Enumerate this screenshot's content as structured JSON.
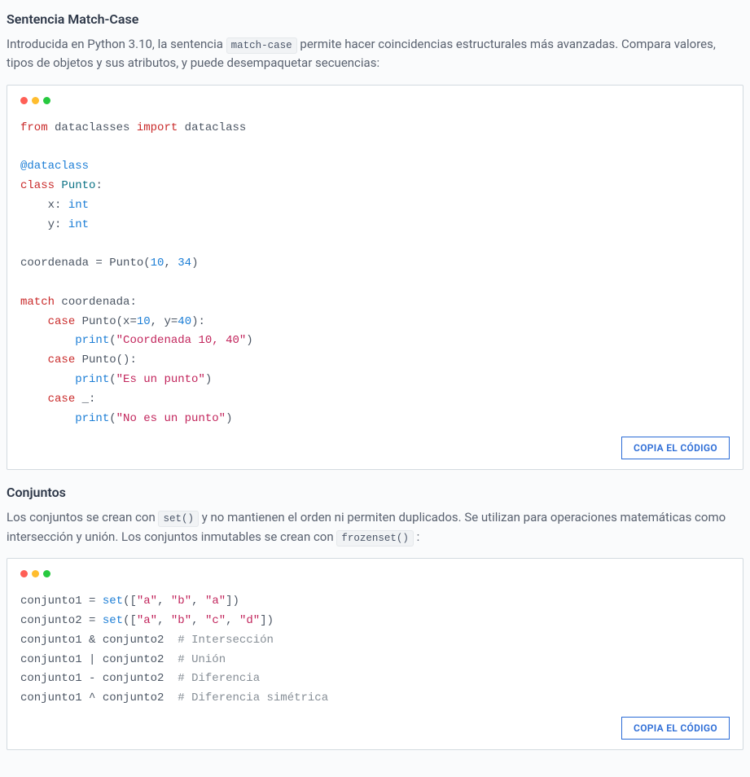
{
  "section1": {
    "heading": "Sentencia Match-Case",
    "intro_pre": "Introducida en Python 3.10, la sentencia ",
    "intro_code": "match-case",
    "intro_post": " permite hacer coincidencias estructurales más avanzadas. Compara valores, tipos de objetos y sus atributos, y puede desempaquetar secuencias:"
  },
  "code1": {
    "from": "from",
    "module": "dataclasses",
    "import": "import",
    "name": "dataclass",
    "deco": "@dataclass",
    "class_kw": "class",
    "class_name": "Punto",
    "field_x": "x",
    "field_y": "y",
    "int_t": "int",
    "assign_lhs": "coordenada",
    "assign_eq": "=",
    "ctor": "Punto",
    "arg1": "10",
    "arg2": "34",
    "match_kw": "match",
    "match_subj": "coordenada",
    "case_kw": "case",
    "c1_cls": "Punto",
    "c1_x": "x",
    "c1_xv": "10",
    "c1_y": "y",
    "c1_yv": "40",
    "print_fn": "print",
    "c1_msg": "\"Coordenada 10, 40\"",
    "c2_cls": "Punto",
    "c2_msg": "\"Es un punto\"",
    "c3_wild": "_",
    "c3_msg": "\"No es un punto\"",
    "copy": "COPIA EL CÓDIGO"
  },
  "section2": {
    "heading": "Conjuntos",
    "intro_pre": "Los conjuntos se crean con ",
    "intro_code1": "set()",
    "intro_mid": " y no mantienen el orden ni permiten duplicados. Se utilizan para operaciones matemáticas como intersección y unión. Los conjuntos inmutables se crean con ",
    "intro_code2": "frozenset()",
    "intro_post": " :"
  },
  "code2": {
    "v1": "conjunto1",
    "v2": "conjunto2",
    "set_fn": "set",
    "l1a": "\"a\"",
    "l1b": "\"b\"",
    "l1c": "\"a\"",
    "l2a": "\"a\"",
    "l2b": "\"b\"",
    "l2c": "\"c\"",
    "l2d": "\"d\"",
    "op_amp": "&",
    "op_pipe": "|",
    "op_minus": "-",
    "op_caret": "^",
    "com_inter": "# Intersección",
    "com_union": "# Unión",
    "com_diff": "# Diferencia",
    "com_sym": "# Diferencia simétrica",
    "copy": "COPIA EL CÓDIGO"
  }
}
